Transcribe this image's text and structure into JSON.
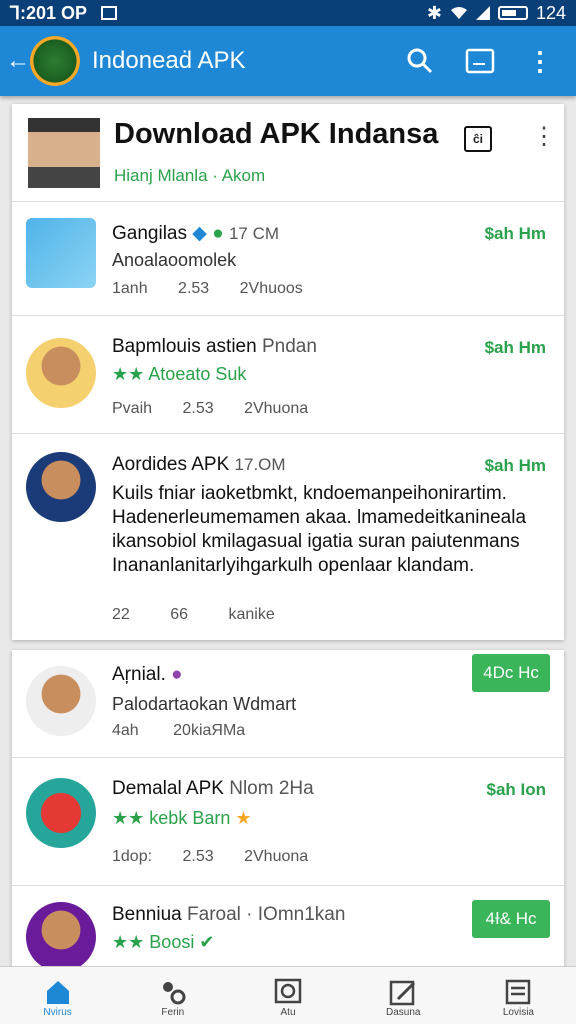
{
  "status": {
    "time": "Ꞁ:201 OP",
    "battery_label": "124"
  },
  "app_bar": {
    "title": "Indoneaḋ APK"
  },
  "header": {
    "title": "Download APK Indansa",
    "subtitle": "Hianj Mlanla · Akom",
    "cal_label": "ĉi"
  },
  "apps": [
    {
      "name": "Gangilas",
      "size": "17 CM",
      "sub": "Anoalaoomolek",
      "meta": [
        "1anh",
        "2.53",
        "2Vhuoos"
      ],
      "price": "$ah Hm"
    },
    {
      "name": "Bapmlouis astien",
      "extra": "Pndan",
      "stars": "★★",
      "sub": "Atoeato Suk",
      "meta": [
        "Pvaih",
        "2.53",
        "2Vhuona"
      ],
      "price": "$ah Hm"
    },
    {
      "name": "Aordides APK",
      "size": "17.OM",
      "desc": "Kuils fniar iaoketbmkt, kndoemanpeihonirartim. Hadenerleumemamen akaa. lmamedeitkanineala ikansobiol kmilagasual igatia suran paiutenmans Inananlanitarlyihgarkulh openlaar klandam.",
      "meta": [
        "22",
        "66",
        "kanike"
      ],
      "price": "$ah Hm"
    },
    {
      "name": "Aŗnial.",
      "sub": "Palodartaokan Wdmart",
      "meta": [
        "4ah",
        "20kiaЯMa"
      ],
      "button": "4Dc Hc"
    },
    {
      "name": "Demalal APK",
      "extra": "Nlom 2Ha",
      "stars": "★★",
      "sub": "kebk Barn",
      "meta": [
        "1dop:",
        "2.53",
        "2Vhuona"
      ],
      "price": "$ah Ion"
    },
    {
      "name": "Benniua",
      "extra": "Faroal · IOmn1kan",
      "stars": "★★",
      "sub": "Boosi",
      "button": "4Ɨ& Hc"
    }
  ],
  "nav": [
    "Nvirus",
    "Ferin",
    "Atu",
    "Dasuna",
    "Lovisia"
  ],
  "colors": {
    "app_bar": "#1e88d6",
    "status_bar": "#0a3f77",
    "accent_green": "#2aa14a"
  }
}
